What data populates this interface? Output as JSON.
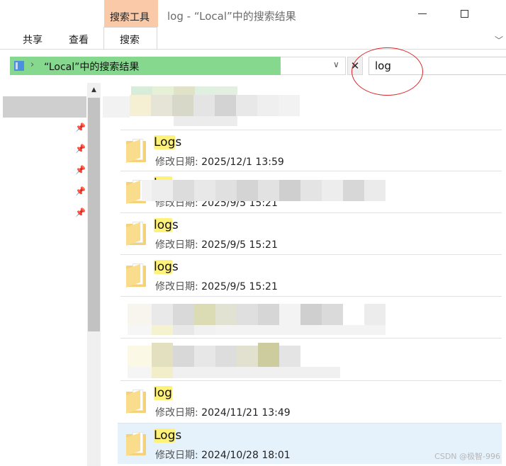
{
  "window": {
    "title": "log - “Local”中的搜索结果",
    "context_tab": "搜索工具"
  },
  "ribbon": {
    "tabs": [
      {
        "label": "共享"
      },
      {
        "label": "查看"
      },
      {
        "label": "搜索"
      }
    ],
    "active_tab": "搜索"
  },
  "address_bar": {
    "path": "“Local”中的搜索结果",
    "clear_icon": "close-icon",
    "highlight_color": "#86d88f"
  },
  "search": {
    "query": "log"
  },
  "results": [
    {
      "prefix": "Log",
      "suffix": "s",
      "meta_label": "修改日期:",
      "meta_value": "2025/12/1 13:59"
    },
    {
      "prefix": "log",
      "suffix": "s",
      "meta_label": "修改日期:",
      "meta_value": "2025/9/5 15:21"
    },
    {
      "prefix": "log",
      "suffix": "s",
      "meta_label": "修改日期:",
      "meta_value": "2025/9/5 15:21"
    },
    {
      "prefix": "log",
      "suffix": "",
      "meta_label": "修改日期:",
      "meta_value": "2024/11/21 13:49"
    },
    {
      "prefix": "Log",
      "suffix": "s",
      "meta_label": "修改日期:",
      "meta_value": "2024/10/28 18:01"
    }
  ],
  "colors": {
    "match_highlight": "#fff27a",
    "selected_row": "#e5f1fb",
    "annotation_ring": "#d9262a",
    "context_tab": "#f9c9a8"
  },
  "watermark": "CSDN @极智-996"
}
